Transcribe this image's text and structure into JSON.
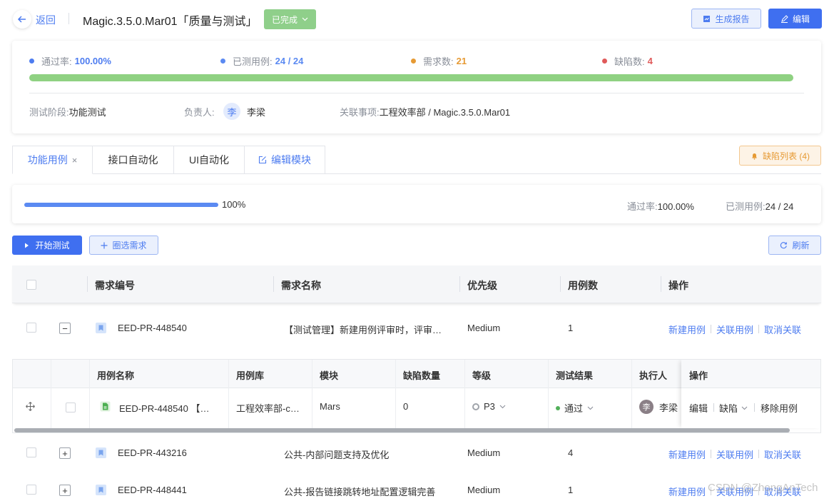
{
  "header": {
    "back_label": "返回",
    "title": "Magic.3.5.0.Mar01「质量与测试」",
    "status": "已完成",
    "report_button": "生成报告",
    "edit_button": "编辑"
  },
  "summary": {
    "pass_rate_label": "通过率:",
    "pass_rate": "100.00%",
    "tested_label": "已测用例:",
    "tested": "24 / 24",
    "requirements_label": "需求数:",
    "requirements": "21",
    "defects_label": "缺陷数:",
    "defects": "4",
    "progress_fraction": 1.0,
    "stage_label": "测试阶段:",
    "stage": "功能测试",
    "owner_label": "负责人:",
    "owner_avatar": "李",
    "owner": "李梁",
    "related_label": "关联事项:",
    "related": "工程效率部 / Magic.3.5.0.Mar01",
    "colors": {
      "pass": "#4d7cf0",
      "tested": "#5b8af2",
      "requirements": "#e69a34",
      "defects": "#e05a5a",
      "bar": "#8fd182"
    }
  },
  "tabs": [
    {
      "label": "功能用例",
      "close": "×"
    },
    {
      "label": "接口自动化"
    },
    {
      "label": "UI自动化"
    },
    {
      "label": "编辑模块"
    }
  ],
  "defect_list_button": "缺陷列表 (4)",
  "progress": {
    "percent_text": "100%",
    "fraction": 1.0,
    "pass_rate_label": "通过率:",
    "pass_rate": "100.00%",
    "tested_label": "已测用例:",
    "tested": "24 / 24"
  },
  "actions": {
    "start": "开始测试",
    "select_requirements": "圈选需求",
    "refresh": "刷新"
  },
  "table": {
    "headers": [
      "需求编号",
      "需求名称",
      "优先级",
      "用例数",
      "操作"
    ],
    "rows": [
      {
        "id": "EED-PR-448540",
        "name": "【测试管理】新建用例评审时，评审…",
        "priority": "Medium",
        "count": "1",
        "expand": "−"
      },
      {
        "id": "EED-PR-443216",
        "name": "公共-内部问题支持及优化",
        "priority": "Medium",
        "count": "4",
        "expand": "+"
      },
      {
        "id": "EED-PR-448441",
        "name": "公共-报告链接跳转地址配置逻辑完善",
        "priority": "Medium",
        "count": "1",
        "expand": "+"
      }
    ],
    "ops": [
      "新建用例",
      "关联用例",
      "取消关联"
    ]
  },
  "subtable": {
    "headers": [
      "用例名称",
      "用例库",
      "模块",
      "缺陷数量",
      "等级",
      "测试结果",
      "执行人",
      "操作"
    ],
    "row": {
      "name": "EED-PR-448540 【…",
      "library": "工程效率部-c…",
      "module": "Mars",
      "defects": "0",
      "level": "P3",
      "result": "通过",
      "executor_avatar": "李",
      "executor": "李梁"
    },
    "ops": [
      "编辑",
      "缺陷",
      "移除用例"
    ]
  },
  "watermark": "CSDN @ZhongAnTech"
}
